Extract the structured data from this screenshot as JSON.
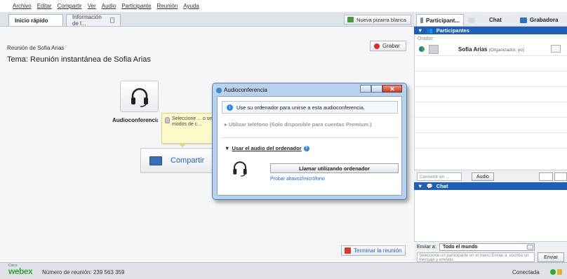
{
  "menu": [
    "Archivo",
    "Editar",
    "Compartir",
    "Ver",
    "Audio",
    "Participante",
    "Reunión",
    "Ayuda"
  ],
  "tabs": {
    "quick_start": "Inicio rápido",
    "info": "Información de l..."
  },
  "whiteboard_button": "Nueva pizarra blanca",
  "record_button": "Grabar",
  "meeting_name": "Reunión de Sofia Arias",
  "topic": "Tema:  Reunión instantánea de Sofia Arias",
  "audio_label": "Audioconferencia",
  "tooltip_text": "Seleccione ... o seleccion... modos de c...",
  "share_label": "Compartir",
  "end_button": "Terminar la reunión",
  "dialog": {
    "title": "Audioconferencia",
    "info": "Use su ordenador para unirse a esta audioconferencia.",
    "phone_option": "Utilizar teléfono (Solo disponible para cuentas Premium.)",
    "pc_option": "Usar el audio del ordenador",
    "call_button": "Llamar utilizando ordenador",
    "test_link": "Probar altavoz/micrófono"
  },
  "right_panel": {
    "tab_participants": "Participant...",
    "tab_chat": "Chat",
    "tab_recorder": "Grabadora",
    "participants_header": "Participantes",
    "speaker_label": "Orador:",
    "host_name": "Sofia Arias",
    "host_role": "(Organizador, yo)",
    "convert_placeholder": "Convertir en ...",
    "audio_button": "Audio",
    "chat_header": "Chat",
    "send_to_label": "Enviar a:",
    "send_to_value": "Todo el mundo",
    "chat_placeholder": "Seleccione un participante en el menú Enviar a, escriba un mensaje y envíelo.",
    "send_button": "Enviar"
  },
  "status": {
    "brand_small": "Cisco",
    "brand": "webex",
    "meeting_number": "Número de reunión: 239 563 359",
    "connection": "Conectada"
  },
  "colors": {
    "accent_blue": "#1f5fb5",
    "webex_green": "#38a635",
    "record_red": "#d92b2b"
  }
}
